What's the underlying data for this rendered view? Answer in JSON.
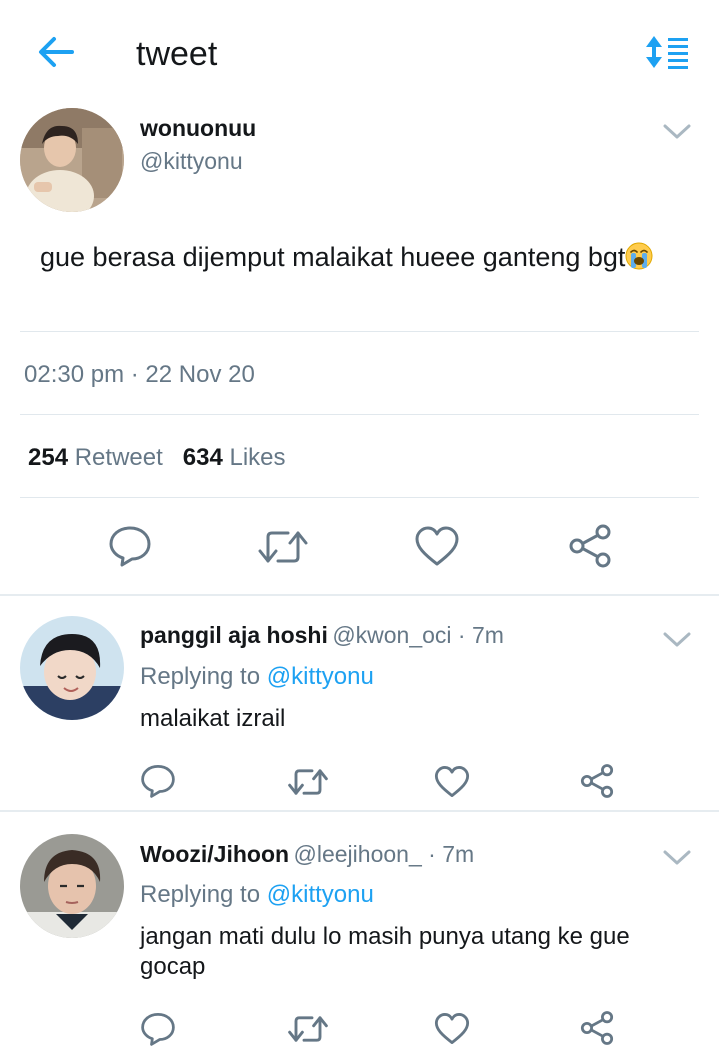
{
  "header": {
    "title": "tweet",
    "back_icon": "arrow-left-icon",
    "sort_icon": "sort-list-icon",
    "accent": "#1da1f2"
  },
  "tweet": {
    "display_name": "wonuonuu",
    "handle": "@kittyonu",
    "text": "gue berasa dijemput malaikat hueee ganteng bgt",
    "emoji": "loudly-crying-face-emoji",
    "time": "02:30 pm",
    "date": "22 Nov 20",
    "retweets": "254",
    "retweets_label": "Retweet",
    "likes": "634",
    "likes_label": "Likes",
    "actions": [
      "reply-icon",
      "retweet-icon",
      "like-icon",
      "share-icon"
    ]
  },
  "replies": [
    {
      "display_name": "panggil aja hoshi",
      "handle": "@kwon_oci",
      "age": "7m",
      "replying_prefix": "Replying to",
      "replying_to": "@kittyonu",
      "text": "malaikat izrail"
    },
    {
      "display_name": "Woozi/Jihoon",
      "handle": "@leejihoon_",
      "age": "7m",
      "replying_prefix": "Replying to",
      "replying_to": "@kittyonu",
      "text": "jangan mati dulu lo masih punya utang ke gue gocap"
    }
  ],
  "colors": {
    "text": "#14171a",
    "secondary": "#657786",
    "link": "#1da1f2",
    "divider": "#e1e8ed"
  }
}
